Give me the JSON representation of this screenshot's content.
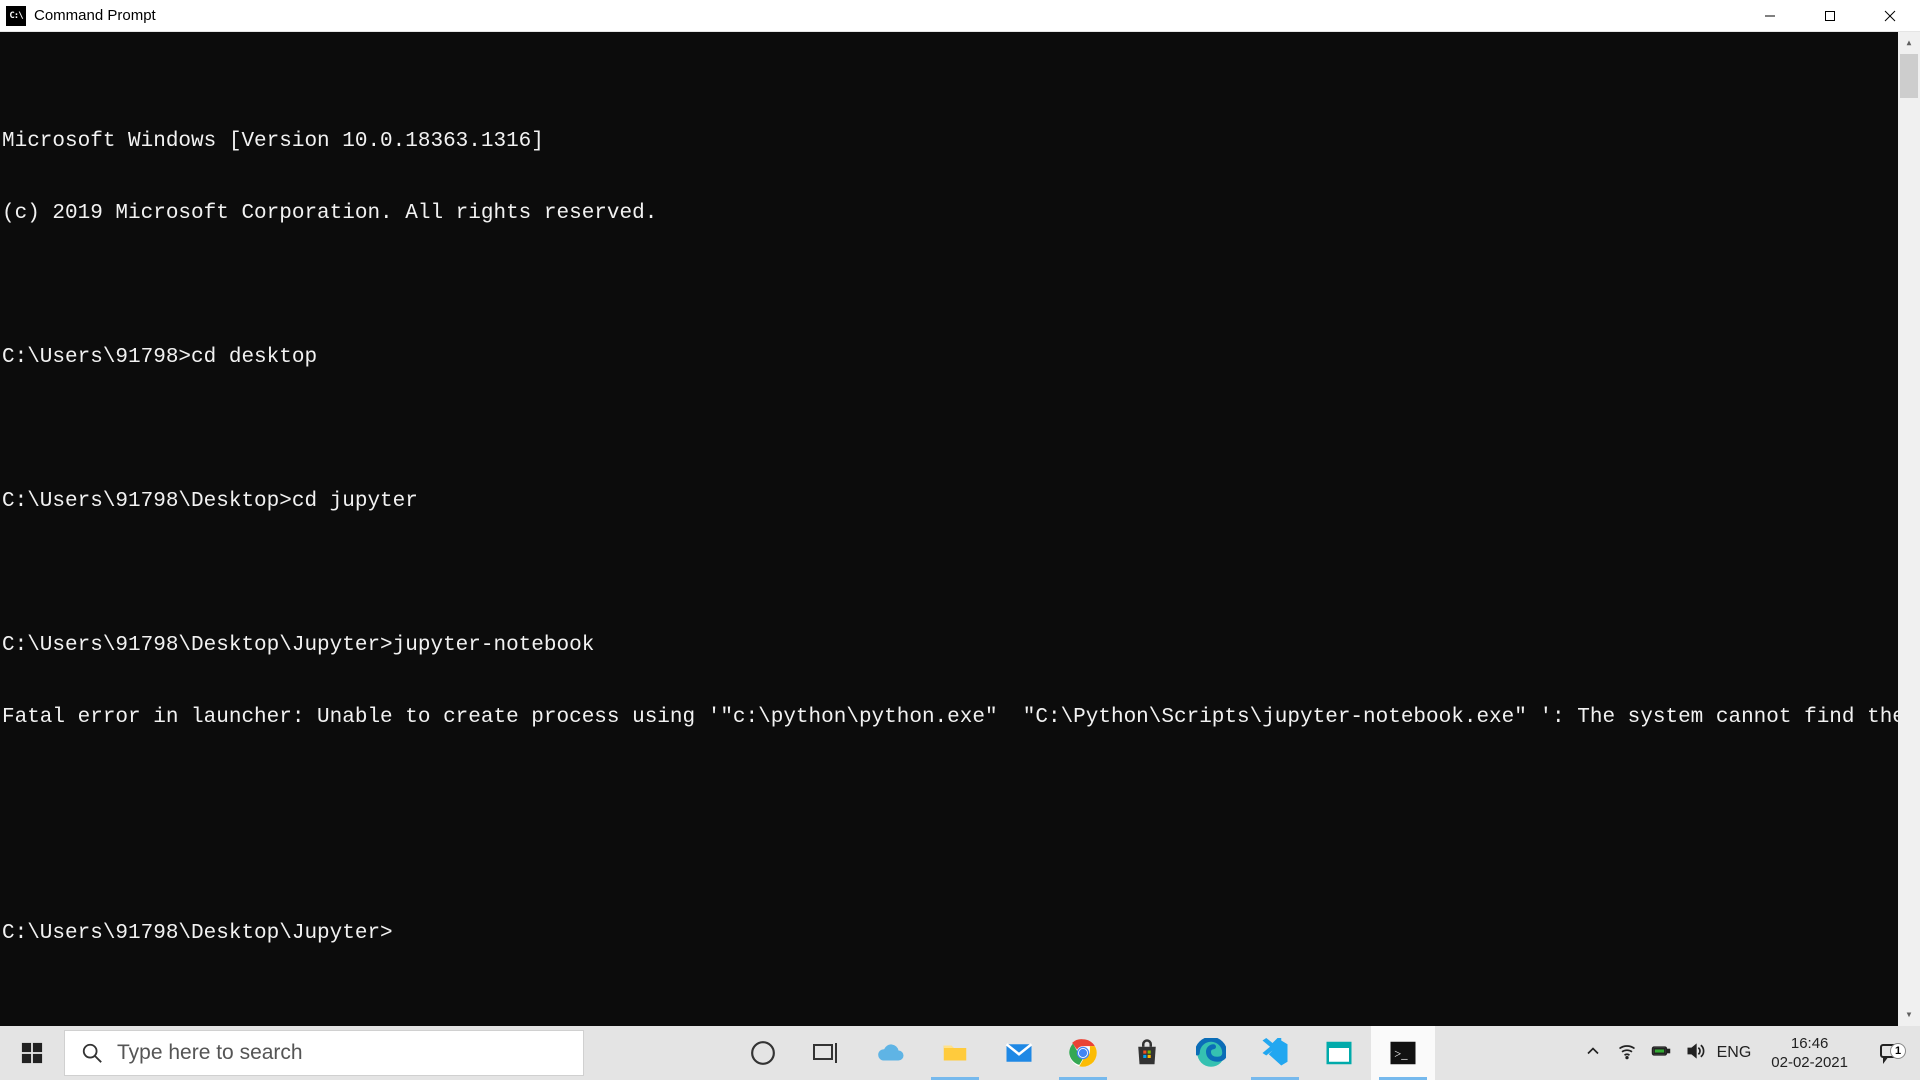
{
  "window": {
    "title": "Command Prompt",
    "icon_label": "C:\\"
  },
  "terminal": {
    "lines": [
      "Microsoft Windows [Version 10.0.18363.1316]",
      "(c) 2019 Microsoft Corporation. All rights reserved.",
      "",
      "C:\\Users\\91798>cd desktop",
      "",
      "C:\\Users\\91798\\Desktop>cd jupyter",
      "",
      "C:\\Users\\91798\\Desktop\\Jupyter>jupyter-notebook",
      "Fatal error in launcher: Unable to create process using '\"c:\\python\\python.exe\"  \"C:\\Python\\Scripts\\jupyter-notebook.exe\" ': The system cannot find the file specified.",
      "",
      "",
      "C:\\Users\\91798\\Desktop\\Jupyter>"
    ]
  },
  "taskbar": {
    "search_placeholder": "Type here to search",
    "language": "ENG",
    "time": "16:46",
    "date": "02-02-2021",
    "notifications": "1"
  }
}
